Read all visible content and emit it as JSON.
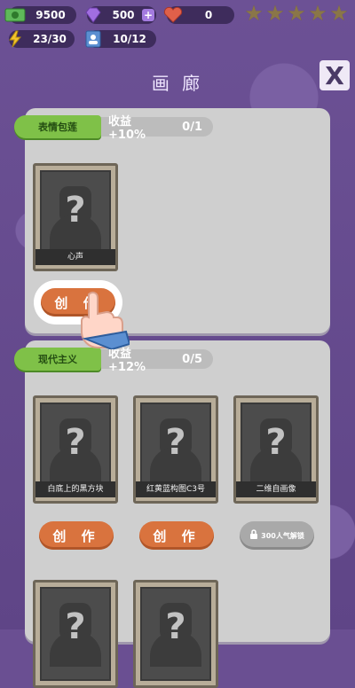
{
  "top": {
    "money": "9500",
    "gems": "500",
    "hearts": "0",
    "energy": "23/30",
    "people": "10/12",
    "stars_filled": 0,
    "stars_total": 5
  },
  "title": "画 廊",
  "close_label": "X",
  "sections": [
    {
      "tab": "表情包莲",
      "bonus_label": "收益",
      "bonus_value": "+10%",
      "count": "0/1",
      "items": [
        {
          "caption": "心声",
          "button": "创 作",
          "locked": false
        }
      ]
    },
    {
      "tab": "现代主义",
      "bonus_label": "收益",
      "bonus_value": "+12%",
      "count": "0/5",
      "items": [
        {
          "caption": "白底上的黑方块",
          "button": "创 作",
          "locked": false
        },
        {
          "caption": "红黄蓝构图C3号",
          "button": "创 作",
          "locked": false
        },
        {
          "caption": "二维自画像",
          "button": "300人气解锁",
          "locked": true
        },
        {
          "caption": "",
          "button": "",
          "locked": true
        },
        {
          "caption": "",
          "button": "",
          "locked": true
        }
      ]
    }
  ],
  "colors": {
    "background": "#6a4f92",
    "panel": "#cfcfcf",
    "tab_green": "#7fc148",
    "button_orange": "#d9733e",
    "locked_gray": "#a9a9a9"
  }
}
